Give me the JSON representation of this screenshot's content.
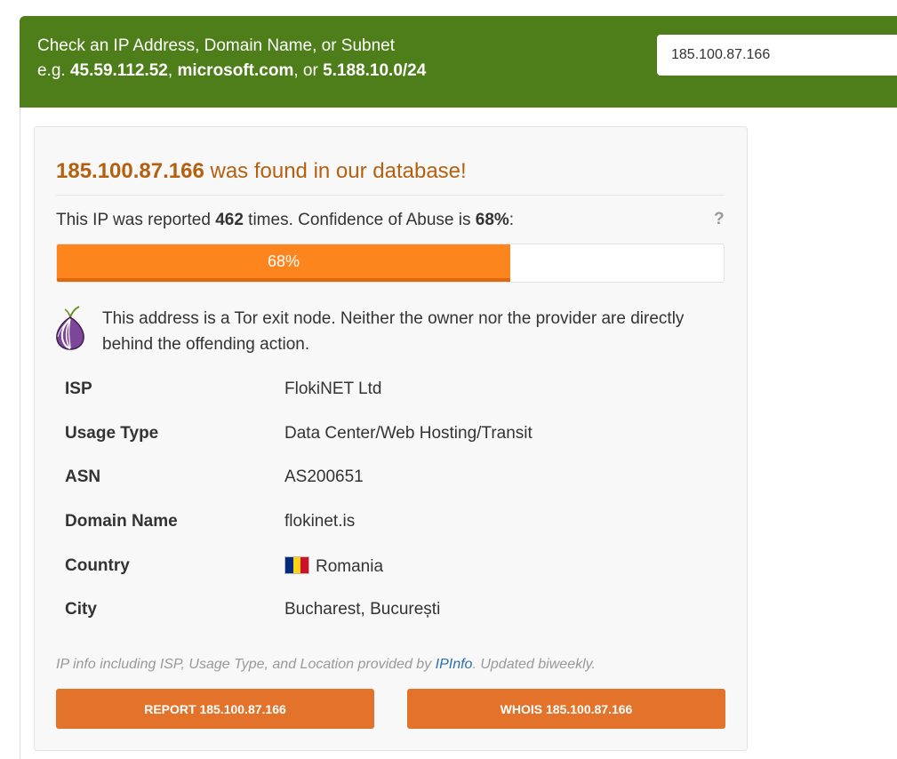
{
  "header": {
    "line1": "Check an IP Address, Domain Name, or Subnet",
    "eg_prefix": "e.g. ",
    "example_ip": "45.59.112.52",
    "sep1": ", ",
    "example_domain": "microsoft.com",
    "sep2": ", or ",
    "example_subnet": "5.188.10.0/24"
  },
  "search": {
    "value": "185.100.87.166"
  },
  "result": {
    "ip": "185.100.87.166",
    "found_text": " was found in our database!",
    "reported_prefix": "This IP was reported ",
    "report_count": "462",
    "reported_middle": " times. Confidence of Abuse is ",
    "confidence": "68%",
    "reported_suffix": ":",
    "help_symbol": "?",
    "confidence_fraction": 0.68,
    "bar_label": "68%",
    "bar_color": "#fd851e"
  },
  "tor": {
    "icon": "tor-onion-icon",
    "text": "This address is a Tor exit node. Neither the owner nor the provider are directly behind the offending action."
  },
  "info": {
    "rows": [
      {
        "label": "ISP",
        "value": "FlokiNET Ltd"
      },
      {
        "label": "Usage Type",
        "value": "Data Center/Web Hosting/Transit"
      },
      {
        "label": "ASN",
        "value": "AS200651"
      },
      {
        "label": "Domain Name",
        "value": "flokinet.is"
      },
      {
        "label": "Country",
        "value": "Romania",
        "flag_colors": [
          "#002b7f",
          "#fcd116",
          "#ce1126"
        ]
      },
      {
        "label": "City",
        "value": "Bucharest, București"
      }
    ]
  },
  "note": {
    "prefix": "IP info including ISP, Usage Type, and Location provided by ",
    "link": "IPInfo",
    "suffix": ". Updated biweekly."
  },
  "buttons": {
    "report": "REPORT 185.100.87.166",
    "whois": "WHOIS 185.100.87.166"
  },
  "colors": {
    "header_green": "#4d7e1a",
    "accent_orange": "#e3722a",
    "found_brown": "#b5600f",
    "link_blue": "#2a6fb0"
  }
}
